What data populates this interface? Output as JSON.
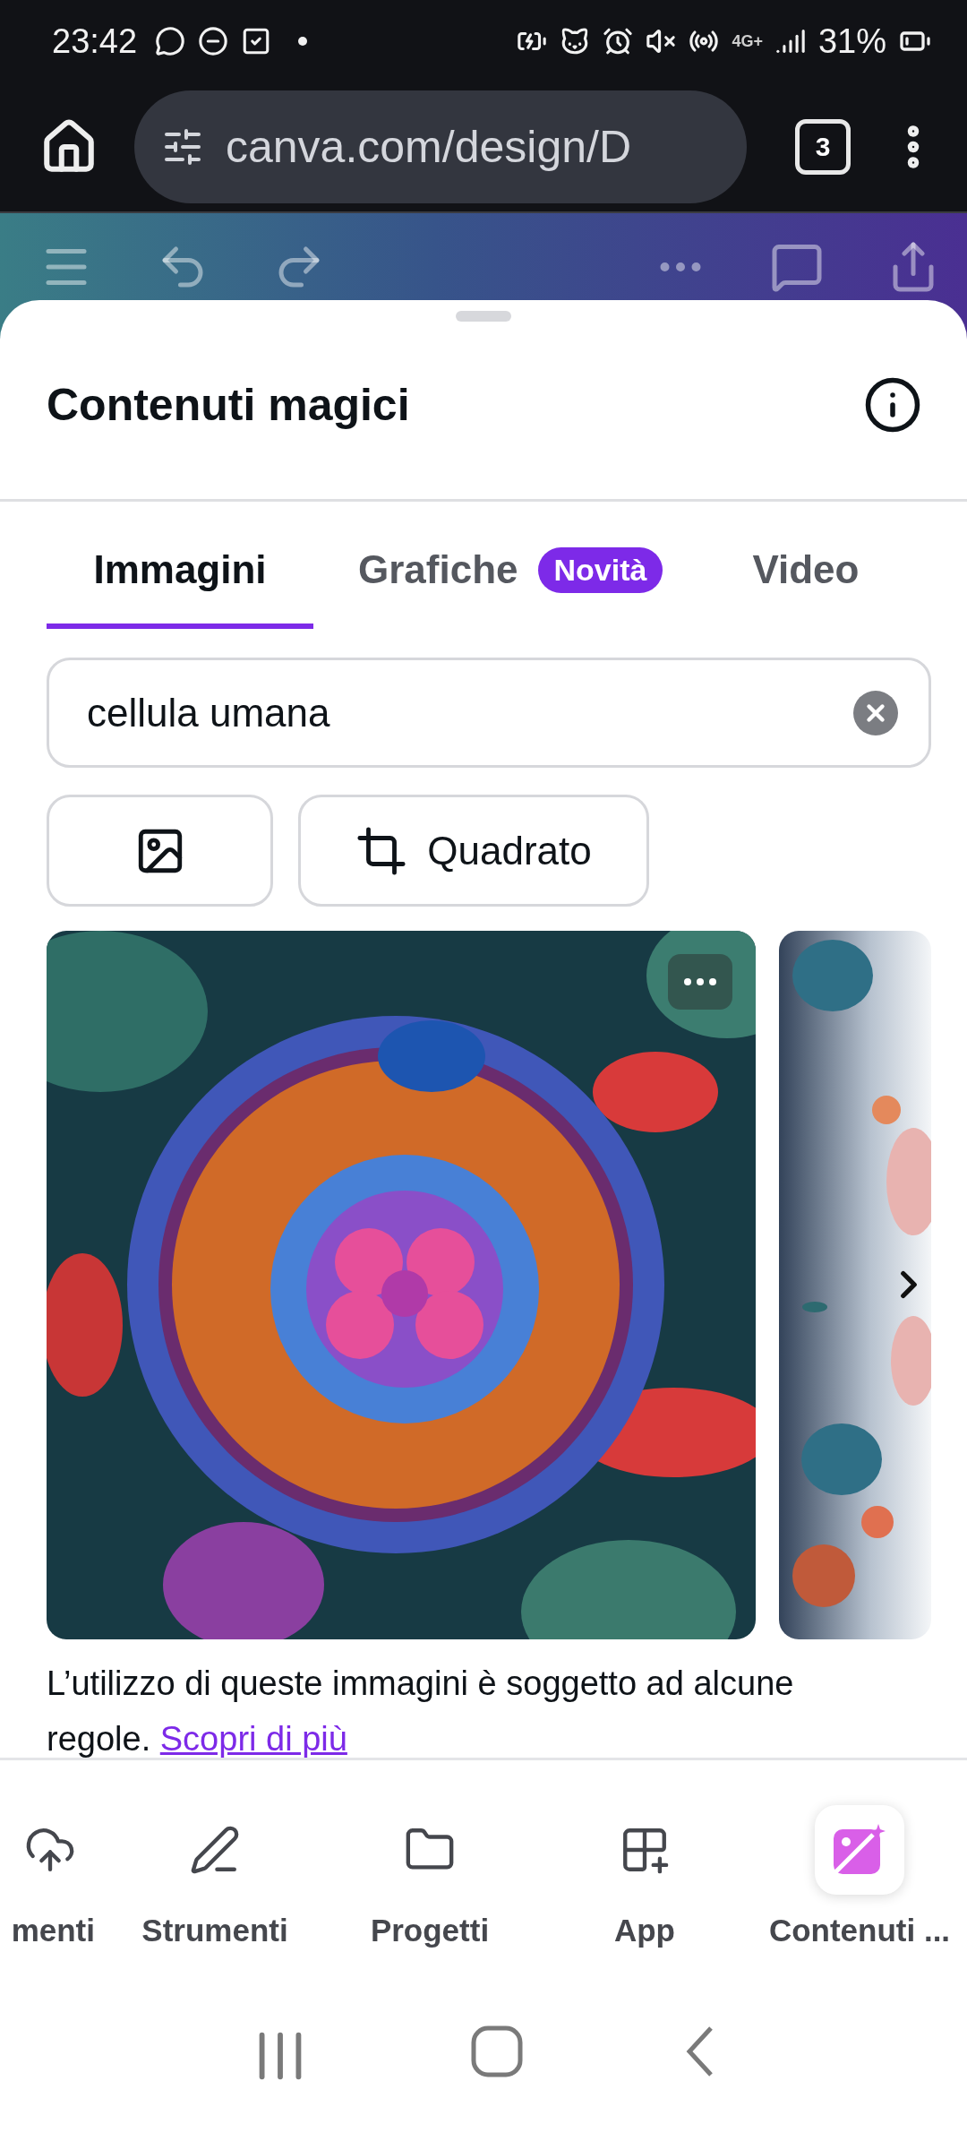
{
  "status_bar": {
    "time": "23:42",
    "network": "4G+",
    "battery": "31%"
  },
  "browser": {
    "url": "canva.com/design/D",
    "tab_count": "3"
  },
  "panel": {
    "title": "Contenuti magici"
  },
  "tabs": [
    {
      "label": "Immagini",
      "selected": true
    },
    {
      "label": "Grafiche",
      "selected": false,
      "badge": "Novità"
    },
    {
      "label": "Video",
      "selected": false
    }
  ],
  "search": {
    "value": "cellula umana"
  },
  "filters": [
    {
      "kind": "style"
    },
    {
      "kind": "ratio",
      "label": "Quadrato"
    }
  ],
  "notice": {
    "text": "L’utilizzo di queste immagini è soggetto ad alcune regole.",
    "link": "Scopri di più"
  },
  "nav": [
    {
      "kind": "upload",
      "label": "menti",
      "selected": false
    },
    {
      "kind": "tools",
      "label": "Strumenti",
      "selected": false
    },
    {
      "kind": "projects",
      "label": "Progetti",
      "selected": false
    },
    {
      "kind": "apps",
      "label": "App",
      "selected": false
    },
    {
      "kind": "magic",
      "label": "Contenuti ...",
      "selected": true
    }
  ]
}
